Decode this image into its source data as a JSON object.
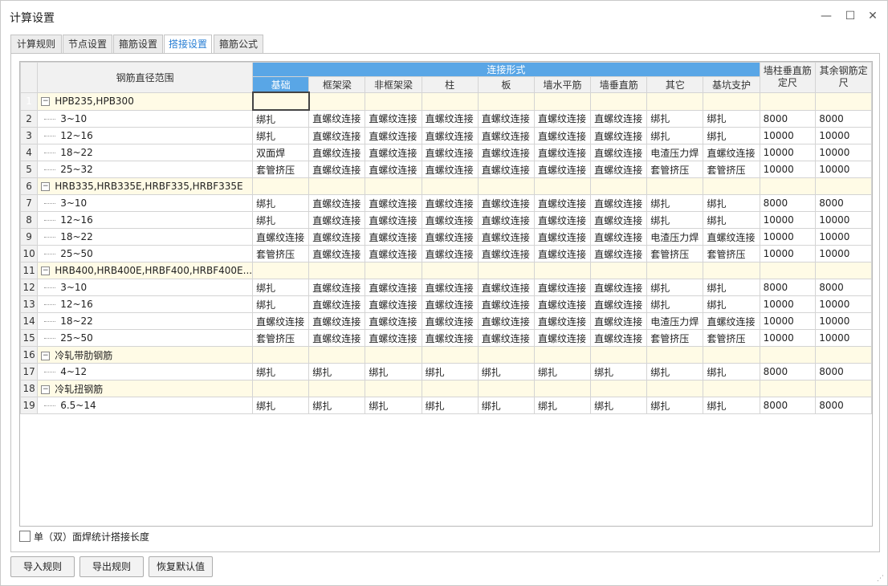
{
  "window": {
    "title": "计算设置"
  },
  "window_controls": {
    "minimize": "—",
    "maximize": "☐",
    "close": "✕"
  },
  "tabs": [
    {
      "label": "计算规则"
    },
    {
      "label": "节点设置"
    },
    {
      "label": "箍筋设置"
    },
    {
      "label": "搭接设置",
      "active": true
    },
    {
      "label": "箍筋公式"
    }
  ],
  "grid": {
    "range_header": "钢筋直径范围",
    "connection_header": "连接形式",
    "column_headers": [
      "基础",
      "框架梁",
      "非框架梁",
      "柱",
      "板",
      "墙水平筋",
      "墙垂直筋",
      "其它",
      "基坑支护"
    ],
    "wall_col_header_1": "墙柱垂直筋",
    "wall_col_header_2": "定尺",
    "other_col_header_1": "其余钢筋定",
    "other_col_header_2": "尺",
    "rows": [
      {
        "num": "1",
        "group": true,
        "label": "HPB235,HPB300",
        "expander": "−"
      },
      {
        "num": "2",
        "label": "3~10",
        "values": [
          "绑扎",
          "直螺纹连接",
          "直螺纹连接",
          "直螺纹连接",
          "直螺纹连接",
          "直螺纹连接",
          "直螺纹连接",
          "绑扎",
          "绑扎",
          "8000",
          "8000"
        ]
      },
      {
        "num": "3",
        "label": "12~16",
        "values": [
          "绑扎",
          "直螺纹连接",
          "直螺纹连接",
          "直螺纹连接",
          "直螺纹连接",
          "直螺纹连接",
          "直螺纹连接",
          "绑扎",
          "绑扎",
          "10000",
          "10000"
        ]
      },
      {
        "num": "4",
        "label": "18~22",
        "values": [
          "双面焊",
          "直螺纹连接",
          "直螺纹连接",
          "直螺纹连接",
          "直螺纹连接",
          "直螺纹连接",
          "直螺纹连接",
          "电渣压力焊",
          "直螺纹连接",
          "10000",
          "10000"
        ]
      },
      {
        "num": "5",
        "label": "25~32",
        "values": [
          "套管挤压",
          "直螺纹连接",
          "直螺纹连接",
          "直螺纹连接",
          "直螺纹连接",
          "直螺纹连接",
          "直螺纹连接",
          "套管挤压",
          "套管挤压",
          "10000",
          "10000"
        ]
      },
      {
        "num": "6",
        "group": true,
        "label": "HRB335,HRB335E,HRBF335,HRBF335E",
        "expander": "−"
      },
      {
        "num": "7",
        "label": "3~10",
        "values": [
          "绑扎",
          "直螺纹连接",
          "直螺纹连接",
          "直螺纹连接",
          "直螺纹连接",
          "直螺纹连接",
          "直螺纹连接",
          "绑扎",
          "绑扎",
          "8000",
          "8000"
        ]
      },
      {
        "num": "8",
        "label": "12~16",
        "values": [
          "绑扎",
          "直螺纹连接",
          "直螺纹连接",
          "直螺纹连接",
          "直螺纹连接",
          "直螺纹连接",
          "直螺纹连接",
          "绑扎",
          "绑扎",
          "10000",
          "10000"
        ]
      },
      {
        "num": "9",
        "label": "18~22",
        "values": [
          "直螺纹连接",
          "直螺纹连接",
          "直螺纹连接",
          "直螺纹连接",
          "直螺纹连接",
          "直螺纹连接",
          "直螺纹连接",
          "电渣压力焊",
          "直螺纹连接",
          "10000",
          "10000"
        ]
      },
      {
        "num": "10",
        "label": "25~50",
        "values": [
          "套管挤压",
          "直螺纹连接",
          "直螺纹连接",
          "直螺纹连接",
          "直螺纹连接",
          "直螺纹连接",
          "直螺纹连接",
          "套管挤压",
          "套管挤压",
          "10000",
          "10000"
        ]
      },
      {
        "num": "11",
        "group": true,
        "label": "HRB400,HRB400E,HRBF400,HRBF400E...",
        "expander": "−"
      },
      {
        "num": "12",
        "label": "3~10",
        "values": [
          "绑扎",
          "直螺纹连接",
          "直螺纹连接",
          "直螺纹连接",
          "直螺纹连接",
          "直螺纹连接",
          "直螺纹连接",
          "绑扎",
          "绑扎",
          "8000",
          "8000"
        ]
      },
      {
        "num": "13",
        "label": "12~16",
        "values": [
          "绑扎",
          "直螺纹连接",
          "直螺纹连接",
          "直螺纹连接",
          "直螺纹连接",
          "直螺纹连接",
          "直螺纹连接",
          "绑扎",
          "绑扎",
          "10000",
          "10000"
        ]
      },
      {
        "num": "14",
        "label": "18~22",
        "values": [
          "直螺纹连接",
          "直螺纹连接",
          "直螺纹连接",
          "直螺纹连接",
          "直螺纹连接",
          "直螺纹连接",
          "直螺纹连接",
          "电渣压力焊",
          "直螺纹连接",
          "10000",
          "10000"
        ]
      },
      {
        "num": "15",
        "label": "25~50",
        "values": [
          "套管挤压",
          "直螺纹连接",
          "直螺纹连接",
          "直螺纹连接",
          "直螺纹连接",
          "直螺纹连接",
          "直螺纹连接",
          "套管挤压",
          "套管挤压",
          "10000",
          "10000"
        ]
      },
      {
        "num": "16",
        "group": true,
        "label": "冷轧带肋钢筋",
        "expander": "−"
      },
      {
        "num": "17",
        "label": "4~12",
        "values": [
          "绑扎",
          "绑扎",
          "绑扎",
          "绑扎",
          "绑扎",
          "绑扎",
          "绑扎",
          "绑扎",
          "绑扎",
          "8000",
          "8000"
        ]
      },
      {
        "num": "18",
        "group": true,
        "label": "冷轧扭钢筋",
        "expander": "−"
      },
      {
        "num": "19",
        "label": "6.5~14",
        "values": [
          "绑扎",
          "绑扎",
          "绑扎",
          "绑扎",
          "绑扎",
          "绑扎",
          "绑扎",
          "绑扎",
          "绑扎",
          "8000",
          "8000"
        ]
      }
    ]
  },
  "checkbox": {
    "label": "单（双）面焊统计搭接长度",
    "checked": false
  },
  "buttons": {
    "import": "导入规则",
    "export": "导出规则",
    "restore": "恢复默认值"
  },
  "colors": {
    "header_accent": "#59a6e6",
    "group_row": "#fffbe6",
    "active_tab_text": "#2a7fd4"
  }
}
